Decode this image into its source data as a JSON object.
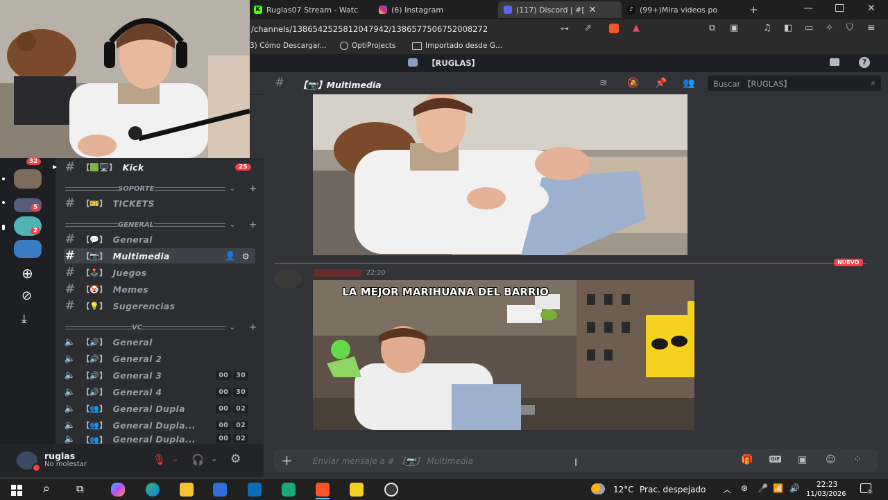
{
  "browser": {
    "tabs": [
      {
        "label": "Ruglas07 Stream - Watc",
        "favicon": "kick-icon",
        "color": "#53fc18"
      },
      {
        "label": "(6) Instagram",
        "favicon": "instagram-icon",
        "color": "#d62976"
      },
      {
        "label": "(117) Discord | #[",
        "favicon": "discord-icon",
        "color": "#5865f2"
      },
      {
        "label": "(99+)Mira videos po",
        "favicon": "tiktok-icon",
        "color": "#ffffff"
      }
    ],
    "url": "/channels/1386542525812047942/1386577506752008272",
    "bookmarks": [
      "3) Cómo Descargar...",
      "OptiProjects",
      "Importado desde G..."
    ]
  },
  "discord": {
    "server_name": "【RUGLAS】",
    "channel_title": "【📷】Multimedia",
    "search_placeholder": "Buscar 【RUGLAS】",
    "guild_badges": [
      "32",
      "5",
      "2"
    ],
    "channels": {
      "kick": {
        "label": "Kick",
        "brackets": "【🟩🖥️】",
        "badge": "25"
      },
      "cat_soporte": "SOPORTE",
      "tickets": {
        "label": "TICKETS",
        "brackets": "【🎫】"
      },
      "cat_general": "GENERAL",
      "general": {
        "label": "General",
        "brackets": "【💬】"
      },
      "multimedia": {
        "label": "Multimedia",
        "brackets": "【📷】"
      },
      "juegos": {
        "label": "Juegos",
        "brackets": "【🕹️】"
      },
      "memes": {
        "label": "Memes",
        "brackets": "【🤡】"
      },
      "sugerencias": {
        "label": "Sugerencias",
        "brackets": "【💡】"
      },
      "cat_vc": "VC",
      "voice": [
        {
          "label": "General",
          "brackets": "【🔊】",
          "count_a": "",
          "count_b": ""
        },
        {
          "label": "General 2",
          "brackets": "【🔊】",
          "count_a": "",
          "count_b": ""
        },
        {
          "label": "General 3",
          "brackets": "【🔊】",
          "count_a": "00",
          "count_b": "30"
        },
        {
          "label": "General 4",
          "brackets": "【🔊】",
          "count_a": "00",
          "count_b": "30"
        },
        {
          "label": "General Dupla",
          "brackets": "【👥】",
          "count_a": "00",
          "count_b": "02"
        },
        {
          "label": "General Dupla...",
          "brackets": "【👥】",
          "count_a": "00",
          "count_b": "02"
        },
        {
          "label": "General Dupla...",
          "brackets": "【👥】",
          "count_a": "00",
          "count_b": "02"
        }
      ]
    },
    "user": {
      "name": "ruglas",
      "status": "No molestar"
    },
    "messages": {
      "new_label": "NUEVO",
      "time": "22:20",
      "meme_text": "LA MEJOR MARIHUANA DEL BARRIO"
    },
    "composer_placeholder": "Enviar mensaje a # 【📷】 Multimedia"
  },
  "taskbar": {
    "temp": "12°C",
    "weather": "Prac. despejado",
    "time": "22:23",
    "date": "11/03/2026",
    "notif": "5"
  }
}
